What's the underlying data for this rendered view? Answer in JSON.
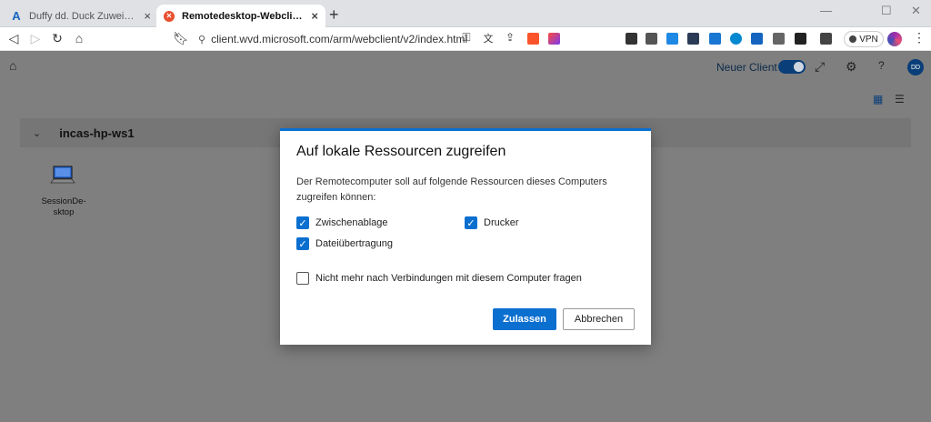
{
  "browser": {
    "tabs": [
      {
        "title": "Duffy dd. Duck Zuweisungen – drilling-av",
        "active": false
      },
      {
        "title": "Remotedesktop-Webclient",
        "active": true
      }
    ],
    "new_tab_label": "+",
    "url": "client.wvd.microsoft.com/arm/webclient/v2/index.html",
    "vpn_label": "VPN"
  },
  "app": {
    "neuer_client_label": "Neuer Client",
    "neuer_client_on": true,
    "avatar_initials": "DD",
    "group": {
      "name": "incas-hp-ws1"
    },
    "resources": [
      {
        "name": "SessionDe-\nsktop"
      }
    ]
  },
  "dialog": {
    "title": "Auf lokale Ressourcen zugreifen",
    "description": "Der Remotecomputer soll auf folgende Ressourcen dieses Computers zugreifen können:",
    "options": {
      "clipboard": {
        "label": "Zwischenablage",
        "checked": true
      },
      "printer": {
        "label": "Drucker",
        "checked": true
      },
      "file_transfer": {
        "label": "Dateiübertragung",
        "checked": true
      },
      "dont_ask": {
        "label": "Nicht mehr nach Verbindungen mit diesem Computer fragen",
        "checked": false
      }
    },
    "allow_label": "Zulassen",
    "cancel_label": "Abbrechen"
  },
  "colors": {
    "accent": "#0b6fd0",
    "overlay": "#7f7f7f",
    "brand_dark": "#0a3e78"
  }
}
